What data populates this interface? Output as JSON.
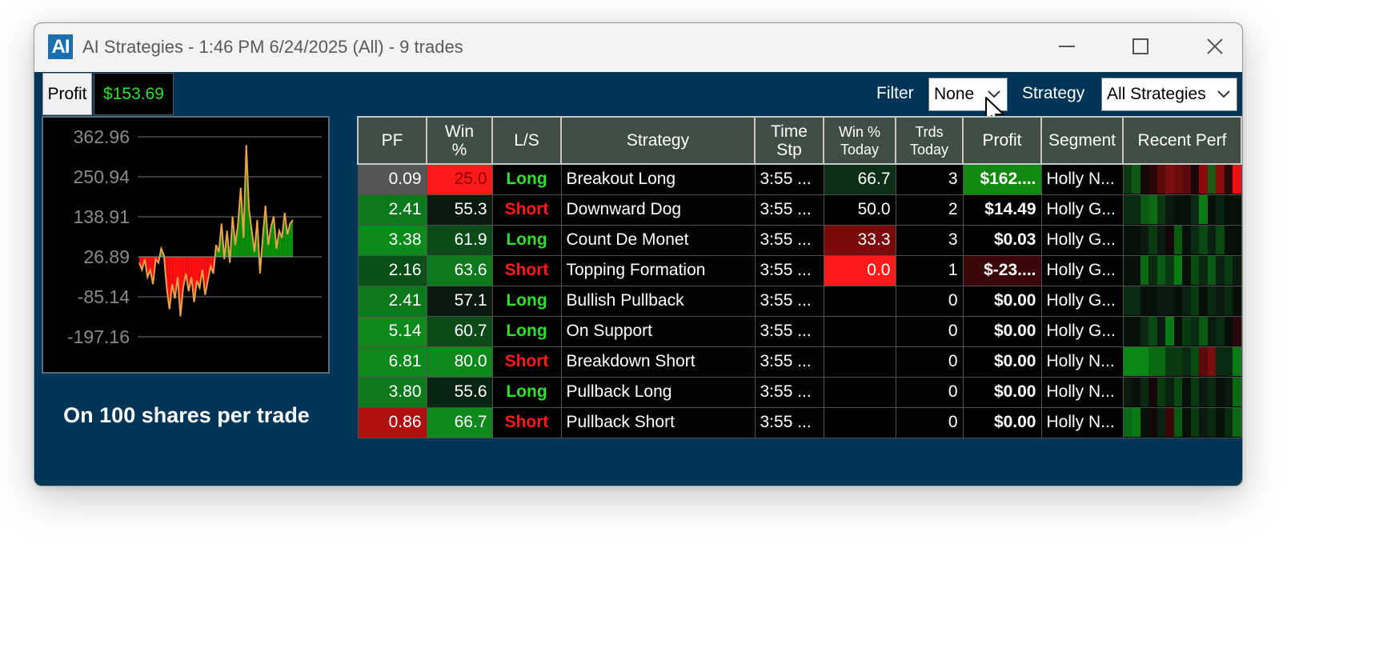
{
  "window": {
    "app_icon_text": "AI",
    "title": "AI Strategies - 1:46 PM 6/24/2025 (All)  - 9 trades",
    "buttons": [
      "minimize-icon",
      "maximize-icon",
      "close-icon"
    ]
  },
  "summary": {
    "profit_label": "Profit",
    "profit_value": "$153.69",
    "caption": "On 100 shares per trade"
  },
  "filters": {
    "filter_label": "Filter",
    "filter_value": "None",
    "strategy_label": "Strategy",
    "strategy_value": "All Strategies"
  },
  "chart_data": {
    "type": "line",
    "title": "",
    "xlabel": "",
    "ylabel": "",
    "y_ticks": [
      "362.96",
      "250.94",
      "138.91",
      "26.89",
      "-85.14",
      "-197.16"
    ],
    "ylim": [
      -197.16,
      362.96
    ],
    "baseline": 26.89,
    "fill": {
      "above": "#0a8f0a",
      "below": "#ff0f0f"
    },
    "line_color": "#e8a24a",
    "grid": true,
    "series": [
      {
        "values": [
          10,
          -10,
          20,
          -30,
          -10,
          -50,
          20,
          10,
          50,
          30,
          -60,
          -120,
          -50,
          -90,
          -30,
          -140,
          -60,
          -20,
          -70,
          -30,
          -100,
          -40,
          -60,
          -10,
          -80,
          -40,
          0,
          -20,
          60,
          40,
          120,
          20,
          100,
          10,
          140,
          60,
          120,
          220,
          80,
          340,
          160,
          100,
          40,
          130,
          -20,
          80,
          170,
          60,
          110,
          140,
          50,
          100,
          80,
          150,
          90,
          120,
          130
        ]
      }
    ]
  },
  "table": {
    "columns": [
      "PF",
      "Win\n%",
      "L/S",
      "Strategy",
      "Time\nStp",
      "Win %\nToday",
      "Trds\nToday",
      "Profit",
      "Segment",
      "Recent Perf"
    ],
    "rows": [
      {
        "pf": "0.09",
        "win": "25.0",
        "ls": "Long",
        "strategy": "Breakout Long",
        "time": "3:55 ...",
        "win_today": "66.7",
        "trades_today": "3",
        "profit": "$162....",
        "segment": "Holly N...",
        "colors": {
          "pf": "#555555",
          "win": "#ff1a1a",
          "win_text": "#8b0000",
          "win_today": "#0c2f16",
          "profit": "#128a12"
        },
        "perf": [
          "#0a3a12",
          "#0e5a14",
          "#140a0a",
          "#2a0808",
          "#5a0a0a",
          "#7a0e0e",
          "#6a0a0a",
          "#5a0a0a",
          "#1a0707",
          "#8a0a0a",
          "#1a5a12",
          "#8a0a0a",
          "#2a0a0a",
          "#ee1111"
        ]
      },
      {
        "pf": "2.41",
        "win": "55.3",
        "ls": "Short",
        "strategy": "Downward Dog",
        "time": "3:55 ...",
        "win_today": "50.0",
        "trades_today": "2",
        "profit": "$14.49",
        "segment": "Holly G...",
        "colors": {
          "pf": "#0c7a1c",
          "win": "#0a1a0e",
          "win_text": "#ffffff",
          "win_today": "#000000",
          "profit": "#000000"
        },
        "perf": [
          "#0a2a12",
          "#0a2a12",
          "#0a5a14",
          "#0f6a17",
          "#0a3a12",
          "#0a1a0e",
          "#05100a",
          "#051008",
          "#0a2a12",
          "#0a7a14",
          "#051008",
          "#0a2010",
          "#051008",
          "#051008"
        ]
      },
      {
        "pf": "3.38",
        "win": "61.9",
        "ls": "Long",
        "strategy": "Count De Monet",
        "time": "3:55 ...",
        "win_today": "33.3",
        "trades_today": "3",
        "profit": "$0.03",
        "segment": "Holly G...",
        "colors": {
          "pf": "#0c8a1c",
          "win": "#0c4a18",
          "win_text": "#ffffff",
          "win_today": "#7a0a0a",
          "profit": "#000000"
        },
        "perf": [
          "#051008",
          "#051008",
          "#0a1a0e",
          "#0a3a12",
          "#0a1a0e",
          "#150707",
          "#0a5a14",
          "#051008",
          "#0a2a12",
          "#0a4a12",
          "#0a2010",
          "#0a4a12",
          "#051008",
          "#051008"
        ]
      },
      {
        "pf": "2.16",
        "win": "63.6",
        "ls": "Short",
        "strategy": "Topping Formation",
        "time": "3:55 ...",
        "win_today": "0.0",
        "trades_today": "1",
        "profit": "$-23....",
        "segment": "Holly G...",
        "colors": {
          "pf": "#095016",
          "win": "#0c7a1c",
          "win_text": "#ffffff",
          "win_today": "#ff1a1a",
          "profit": "#3a0808"
        },
        "perf": [
          "#051008",
          "#051008",
          "#0a6a14",
          "#0a2a12",
          "#0a5a14",
          "#0a3a12",
          "#0a7a14",
          "#051008",
          "#0a4a12",
          "#0a2a12",
          "#0a5a14",
          "#0a2010",
          "#0a3a12",
          "#0a1a0e"
        ]
      },
      {
        "pf": "2.41",
        "win": "57.1",
        "ls": "Long",
        "strategy": "Bullish Pullback",
        "time": "3:55 ...",
        "win_today": "",
        "trades_today": "0",
        "profit": "$0.00",
        "segment": "Holly G...",
        "colors": {
          "pf": "#0c7a1c",
          "win": "#0a1a0e",
          "win_text": "#ffffff",
          "win_today": "#000000",
          "profit": "#000000"
        },
        "perf": [
          "#0a2a12",
          "#0a2a12",
          "#051008",
          "#051008",
          "#0a1a0e",
          "#0a1a0e",
          "#051008",
          "#0a2010",
          "#0a3a12",
          "#051008",
          "#0a2a12",
          "#0a1a0e",
          "#0a2a12",
          "#051008"
        ]
      },
      {
        "pf": "5.14",
        "win": "60.7",
        "ls": "Long",
        "strategy": "On Support",
        "time": "3:55 ...",
        "win_today": "",
        "trades_today": "0",
        "profit": "$0.00",
        "segment": "Holly G...",
        "colors": {
          "pf": "#0c8a1c",
          "win": "#0c4a18",
          "win_text": "#ffffff",
          "win_today": "#000000",
          "profit": "#000000"
        },
        "perf": [
          "#051008",
          "#051008",
          "#0a2a12",
          "#0a4a12",
          "#0a1a0e",
          "#0a7a14",
          "#051008",
          "#0a3a12",
          "#0a2a12",
          "#0a5a14",
          "#0a1a0e",
          "#0a2a12",
          "#051008",
          "#2a0808"
        ]
      },
      {
        "pf": "6.81",
        "win": "80.0",
        "ls": "Short",
        "strategy": "Breakdown Short",
        "time": "3:55 ...",
        "win_today": "",
        "trades_today": "0",
        "profit": "$0.00",
        "segment": "Holly N...",
        "colors": {
          "pf": "#0c8a1c",
          "win": "#0c8a1c",
          "win_text": "#ffffff",
          "win_today": "#000000",
          "profit": "#000000"
        },
        "perf": [
          "#0a8a14",
          "#0a8a14",
          "#0a8a14",
          "#0a6a14",
          "#0a6a14",
          "#0a3a12",
          "#0a3a12",
          "#0a2a12",
          "#0a4a12",
          "#5a0a0a",
          "#7a0e0e",
          "#0a2a12",
          "#0a2a12",
          "#0a7a14"
        ]
      },
      {
        "pf": "3.80",
        "win": "55.6",
        "ls": "Long",
        "strategy": "Pullback Long",
        "time": "3:55 ...",
        "win_today": "",
        "trades_today": "0",
        "profit": "$0.00",
        "segment": "Holly N...",
        "colors": {
          "pf": "#0c7a1c",
          "win": "#0a2612",
          "win_text": "#ffffff",
          "win_today": "#000000",
          "profit": "#000000"
        },
        "perf": [
          "#0a1a0e",
          "#051008",
          "#0a2a12",
          "#150707",
          "#0a3a12",
          "#0a2010",
          "#0a4a12",
          "#051008",
          "#0a3a12",
          "#0a1a0e",
          "#0a2a12",
          "#051008",
          "#0a1a0e",
          "#0a6a14"
        ]
      },
      {
        "pf": "0.86",
        "win": "66.7",
        "ls": "Short",
        "strategy": "Pullback Short",
        "time": "3:55 ...",
        "win_today": "",
        "trades_today": "0",
        "profit": "$0.00",
        "segment": "Holly N...",
        "colors": {
          "pf": "#b01010",
          "win": "#0c8a1c",
          "win_text": "#ffffff",
          "win_today": "#000000",
          "profit": "#000000"
        },
        "perf": [
          "#0a6a14",
          "#0a7a14",
          "#051008",
          "#150707",
          "#0a2010",
          "#3a0808",
          "#0a5a14",
          "#051008",
          "#0a3a12",
          "#0a1a0e",
          "#0a2a12",
          "#051008",
          "#0a2a12",
          "#0a6a14"
        ]
      }
    ]
  },
  "colors": {
    "window_bg": "#003557",
    "long": "#2fe02f",
    "short": "#ff1a1a"
  }
}
